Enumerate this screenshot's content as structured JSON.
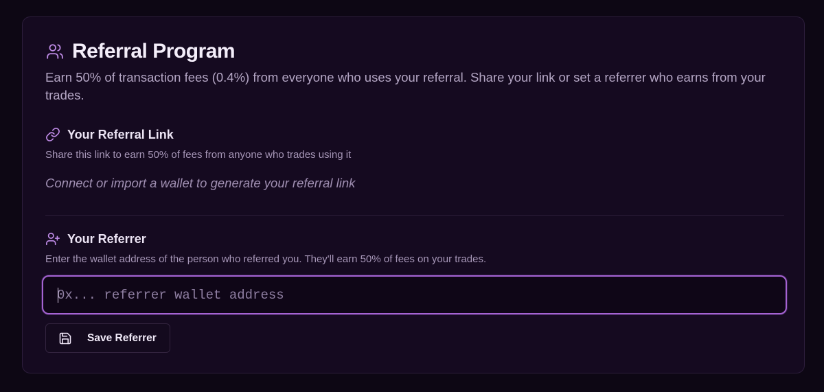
{
  "referral": {
    "title": "Referral Program",
    "description": "Earn 50% of transaction fees (0.4%) from everyone who uses your referral. Share your link or set a referrer who earns from your trades.",
    "header_icon": "users-icon"
  },
  "link_section": {
    "title": "Your Referral Link",
    "subtitle": "Share this link to earn 50% of fees from anyone who trades using it",
    "empty_message": "Connect or import a wallet to generate your referral link",
    "icon": "link-icon"
  },
  "referrer_section": {
    "title": "Your Referrer",
    "subtitle": "Enter the wallet address of the person who referred you. They'll earn 50% of fees on your trades.",
    "icon": "user-plus-icon",
    "input": {
      "value": "",
      "placeholder": "0x... referrer wallet address"
    },
    "save_label": "Save Referrer",
    "save_icon": "save-icon"
  },
  "colors": {
    "background": "#0d0714",
    "card": "#150a20",
    "accent": "#a563d3",
    "icon": "#c08ce8"
  }
}
